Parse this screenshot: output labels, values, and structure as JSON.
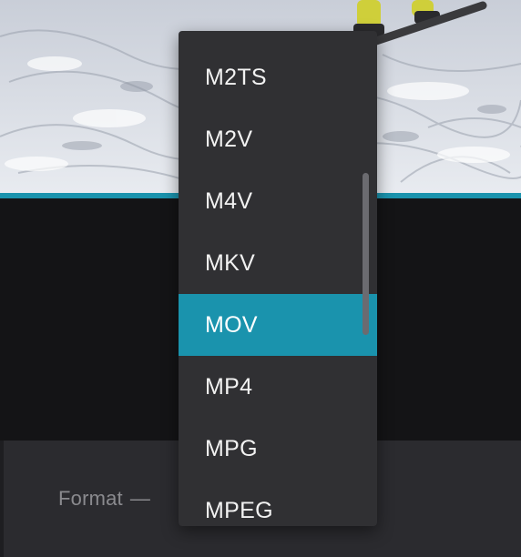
{
  "dropdown": {
    "items": [
      {
        "label": "M2TS"
      },
      {
        "label": "M2V"
      },
      {
        "label": "M4V"
      },
      {
        "label": "MKV"
      },
      {
        "label": "MOV",
        "selected": true
      },
      {
        "label": "MP4"
      },
      {
        "label": "MPG"
      },
      {
        "label": "MPEG"
      }
    ]
  },
  "settings": {
    "format_label": "Format",
    "format_separator": "—"
  },
  "colors": {
    "accent": "#1a93ad",
    "dropdown_bg": "#303033",
    "panel_bg": "#2b2b2f",
    "dark_bg": "#141416"
  }
}
